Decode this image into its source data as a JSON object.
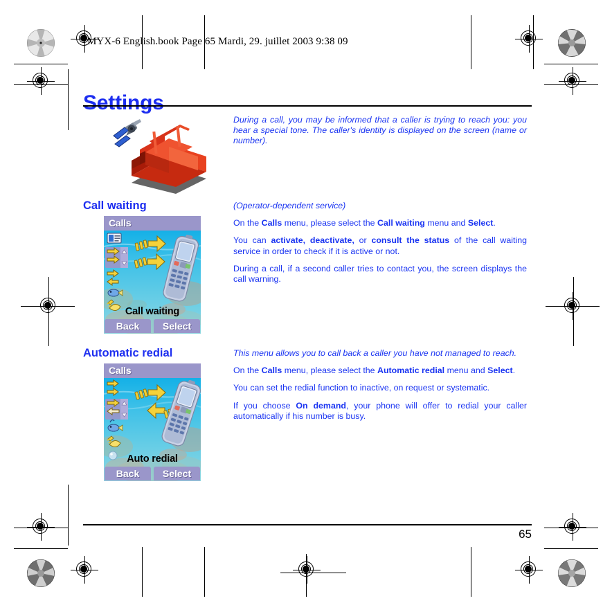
{
  "print": {
    "filename_header": "MYX-6 English.book  Page 65  Mardi, 29. juillet 2003  9:38 09"
  },
  "page": {
    "title": "Settings",
    "number": "65"
  },
  "intro": {
    "text": "During a call, you may be informed that a caller is trying to reach you: you hear a special tone. The caller's identity is displayed on the screen (name or number)."
  },
  "illustration": {
    "alt": "toolbox-with-pliers"
  },
  "sections": [
    {
      "heading": "Call waiting",
      "subtitle": "(Operator-dependent service)",
      "paragraphs": [
        {
          "runs": [
            {
              "t": "On the "
            },
            {
              "t": "Calls",
              "b": true
            },
            {
              "t": " menu, please select the "
            },
            {
              "t": "Call waiting",
              "b": true
            },
            {
              "t": " menu and "
            },
            {
              "t": "Select",
              "b": true
            },
            {
              "t": "."
            }
          ]
        },
        {
          "runs": [
            {
              "t": "You can "
            },
            {
              "t": "activate, deactivate,",
              "b": true
            },
            {
              "t": " or "
            },
            {
              "t": "consult the status",
              "b": true
            },
            {
              "t": " of the call waiting service in order to check if it is active or not."
            }
          ]
        },
        {
          "runs": [
            {
              "t": "During a call, if a second caller tries to contact you, the screen displays the call warning."
            }
          ]
        }
      ],
      "screenshot": {
        "title": "Calls",
        "caption": "Call waiting",
        "left_softkey": "Back",
        "right_softkey": "Select"
      }
    },
    {
      "heading": "Automatic redial",
      "subtitle": "This menu allows you to call back a caller you have not managed to reach.",
      "paragraphs": [
        {
          "runs": [
            {
              "t": "On the "
            },
            {
              "t": "Calls",
              "b": true
            },
            {
              "t": " menu, please select the "
            },
            {
              "t": "Automatic redial",
              "b": true
            },
            {
              "t": " menu and "
            },
            {
              "t": "Select",
              "b": true
            },
            {
              "t": "."
            }
          ]
        },
        {
          "runs": [
            {
              "t": "You can set the redial function to inactive, on request or systematic."
            }
          ]
        },
        {
          "runs": [
            {
              "t": "If you choose "
            },
            {
              "t": "On demand",
              "b": true
            },
            {
              "t": ", your phone will offer to redial your caller automatically if his number is busy."
            }
          ]
        }
      ],
      "screenshot": {
        "title": "Calls",
        "caption": "Auto redial",
        "left_softkey": "Back",
        "right_softkey": "Select"
      }
    }
  ],
  "colors": {
    "heading_blue": "#1d2ef0",
    "body_blue": "#1a34f2",
    "screen_titlebar": "#9a96ca",
    "screen_water": "#2fb4e8",
    "toolbox_red": "#d42a11"
  }
}
